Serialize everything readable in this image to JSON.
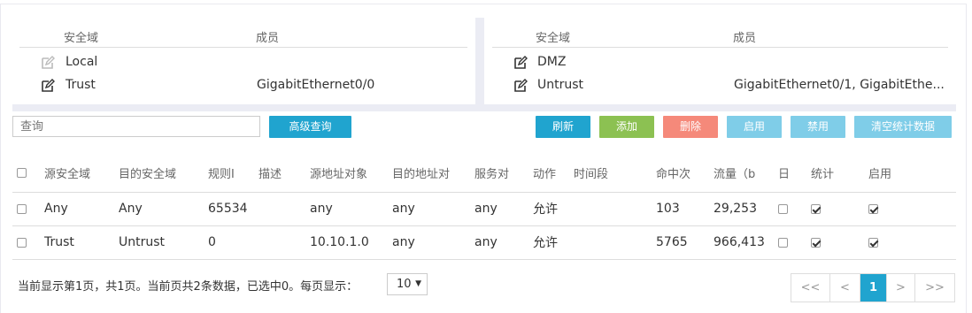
{
  "zones_left": {
    "header": {
      "zone": "安全域",
      "members": "成员"
    },
    "rows": [
      {
        "name": "Local",
        "members": "",
        "editable": false
      },
      {
        "name": "Trust",
        "members": "GigabitEthernet0/0",
        "editable": true
      }
    ]
  },
  "zones_right": {
    "header": {
      "zone": "安全域",
      "members": "成员"
    },
    "rows": [
      {
        "name": "DMZ",
        "members": "",
        "editable": true
      },
      {
        "name": "Untrust",
        "members": "GigabitEthernet0/1, GigabitEthe...",
        "editable": true
      }
    ]
  },
  "toolbar": {
    "search_placeholder": "查询",
    "advanced_search": "高级查询",
    "refresh": "刷新",
    "add": "添加",
    "delete": "删除",
    "enable": "启用",
    "disable": "禁用",
    "clear_stats": "清空统计数据"
  },
  "colors": {
    "advanced": "#20a4cf",
    "refresh": "#20a4cf",
    "add": "#8cc152",
    "delete": "#f5897a",
    "enable": "#7fcde8",
    "disable": "#7fcde8",
    "clear": "#7fcde8"
  },
  "table": {
    "columns": [
      "源安全域",
      "目的安全域",
      "规则I",
      "描述",
      "源地址对象",
      "目的地址对",
      "服务对",
      "动作",
      "时间段",
      "命中次",
      "流量（b",
      "日",
      "统计",
      "启用"
    ],
    "rows": [
      {
        "src_zone": "Any",
        "dst_zone": "Any",
        "rule_id": "65534",
        "desc": "",
        "src_addr": "any",
        "dst_addr": "any",
        "service": "any",
        "action": "允许",
        "time": "",
        "hits": "103",
        "traffic": "29,253",
        "log": false,
        "stats": true,
        "enabled": true
      },
      {
        "src_zone": "Trust",
        "dst_zone": "Untrust",
        "rule_id": "0",
        "desc": "",
        "src_addr": "10.10.1.0",
        "dst_addr": "any",
        "service": "any",
        "action": "允许",
        "time": "",
        "hits": "5765",
        "traffic": "966,413",
        "log": false,
        "stats": true,
        "enabled": true
      }
    ]
  },
  "footer": {
    "summary": "当前显示第1页，共1页。当前页共2条数据，已选中0。每页显示：",
    "page_size": "10"
  },
  "pager": {
    "first": "<<",
    "prev": "<",
    "current": "1",
    "next": ">",
    "last": ">>"
  }
}
